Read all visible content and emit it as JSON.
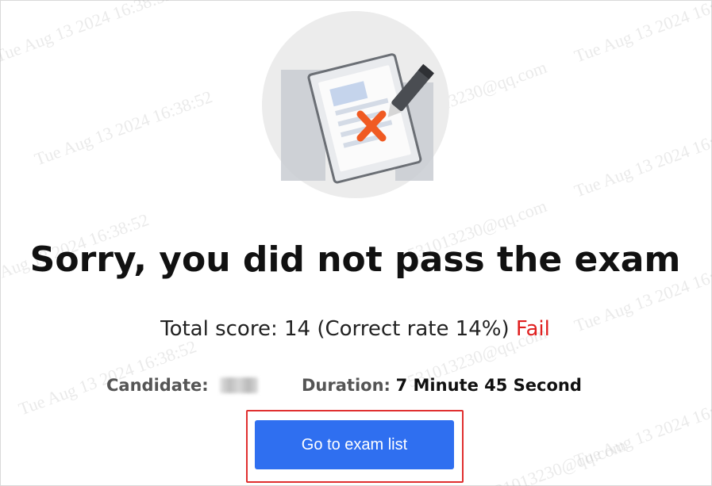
{
  "result": {
    "title": "Sorry, you did not pass the exam",
    "score_text": "Total score: 14 (Correct rate 14%)",
    "status_label": "Fail"
  },
  "info": {
    "candidate_label": "Candidate:",
    "duration_label": "Duration:",
    "duration_value": "7 Minute 45 Second"
  },
  "actions": {
    "go_to_list_label": "Go to exam list"
  },
  "watermark": {
    "texts": [
      "Tue Aug 13 2024 16:38:52",
      "531013230@qq.com"
    ]
  },
  "colors": {
    "button": "#2f6ff0",
    "fail": "#e02020",
    "highlight_border": "#e03030"
  }
}
